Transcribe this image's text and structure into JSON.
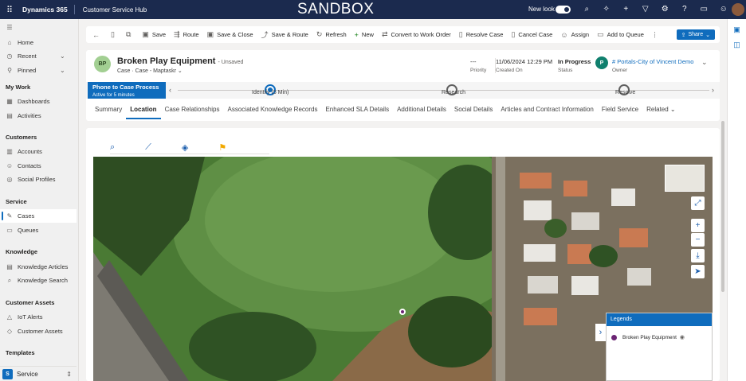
{
  "topbar": {
    "brand": "Dynamics 365",
    "app": "Customer Service Hub",
    "env_label": "SANDBOX",
    "new_look": "New look",
    "icons": [
      "search-icon",
      "lightbulb-icon",
      "plus-icon",
      "filter-icon",
      "gear-icon",
      "help-icon",
      "chat-icon",
      "smile-icon"
    ]
  },
  "nav": {
    "home": "Home",
    "recent": "Recent",
    "pinned": "Pinned",
    "section_mywork": "My Work",
    "dashboards": "Dashboards",
    "activities": "Activities",
    "section_customers": "Customers",
    "accounts": "Accounts",
    "contacts": "Contacts",
    "social_profiles": "Social Profiles",
    "section_service": "Service",
    "cases": "Cases",
    "queues": "Queues",
    "section_knowledge": "Knowledge",
    "knowledge_articles": "Knowledge Articles",
    "knowledge_search": "Knowledge Search",
    "section_assets": "Customer Assets",
    "iot_alerts": "IoT Alerts",
    "customer_assets": "Customer Assets",
    "section_templates": "Templates",
    "area_badge": "S",
    "area_label": "Service"
  },
  "commands": {
    "save": "Save",
    "route": "Route",
    "save_close": "Save & Close",
    "save_route": "Save & Route",
    "refresh": "Refresh",
    "new": "New",
    "convert": "Convert to Work Order",
    "resolve": "Resolve Case",
    "cancel": "Cancel Case",
    "assign": "Assign",
    "add_queue": "Add to Queue",
    "more": "⋮",
    "share": "Share"
  },
  "record": {
    "initials": "BP",
    "title": "Broken Play Equipment",
    "status_text": "- Unsaved",
    "entity": "Case",
    "form": "Case - Maptaskr",
    "priority_value": "---",
    "priority_label": "Priority",
    "created_value": "11/06/2024 12:29 PM",
    "created_label": "Created On",
    "status_value": "In Progress",
    "status_label": "Status",
    "owner_initial": "P",
    "owner_value": "# Portals-City of Vincent Demo",
    "owner_label": "Owner"
  },
  "bpf": {
    "process_name": "Phone to Case Process",
    "active_for": "Active for 5 minutes",
    "stages": [
      "Identify  (5 Min)",
      "Research",
      "Resolve"
    ]
  },
  "tabs": [
    "Summary",
    "Location",
    "Case Relationships",
    "Associated Knowledge Records",
    "Enhanced SLA Details",
    "Additional Details",
    "Social Details",
    "Articles and Contract Information",
    "Field Service",
    "Related"
  ],
  "legend": {
    "title": "Legends",
    "item": "Broken Play Equipment"
  },
  "colors": {
    "topbar": "#1b2a4e",
    "accent": "#0f6cbd",
    "pin": "#6b2574"
  }
}
